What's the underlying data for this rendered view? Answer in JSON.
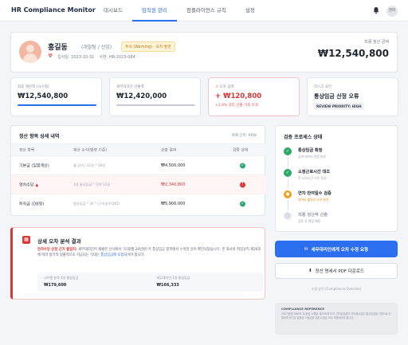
{
  "header": {
    "brand": "HR Compliance Monitor",
    "nav": [
      "대시보드",
      "임직원 관리",
      "컴플라이언스 규칙",
      "설정"
    ],
    "active_nav": "임직원 관리",
    "user_avatar": "관리"
  },
  "profile": {
    "name": "홍길동",
    "dept": "(개발팀 / 선임)",
    "badge": "주의 (Warning) · 오차 발견",
    "hire_date": "입사일: 2023-10-31",
    "emp_id": "사번: HR-2023-084",
    "total_label": "최종 정산 금액",
    "total_value": "₩12,540,800"
  },
  "stats": [
    {
      "label": "최종 계산액 (시스템)",
      "value": "₩12,540,800",
      "accent": "#2b6ff0"
    },
    {
      "label": "세무대리인 산출액",
      "value": "₩12,420,000",
      "accent": "#8a90a0"
    },
    {
      "label": "오차 금액",
      "value": "+ ₩120,800",
      "sub": "+1.0% 과다 산출 기준 초과",
      "accent": "#d93636"
    },
    {
      "label": "리스크 요인",
      "value": "통상임금 산정 오류",
      "tag": "REVIEW PRIORITY: HIGH"
    }
  ],
  "table": {
    "title": "정산 항목 상세 내역",
    "unit": "화폐 단위: KRW",
    "headers": [
      "정산 항목",
      "계산 수식(법정 기준)",
      "산출 결과",
      "검증 상태"
    ],
    "rows": [
      {
        "item": "기본급 (일할계산)",
        "formula": "월 급여 / 31일 * 28일",
        "result": "₩4,500,000",
        "status": "ok"
      },
      {
        "item": "연차수당",
        "formula": "1일 통상임금 * 잔여 12일",
        "result": "₩2,340,800",
        "status": "error"
      },
      {
        "item": "퇴직금 (DB형)",
        "formula": "평균임금 * 30 * (근속일수/365)",
        "result": "₩5,900,000",
        "status": "ok"
      }
    ]
  },
  "analysis": {
    "title": "상세 오차 분석 결과",
    "highlight": "연차수당 산정 근거 불일치:",
    "text_main": " 세무대리인이 제출한 산식에서 '식대(월 20만원)'가 통상임금 항목에서 누락된 것이 확인되었습니다. 본 회사의 취업규칙 제26조에 따라 정기적·일률적으로 지급되는 식대는 ",
    "link": "통상임금에 포함",
    "text_end": "되어야 합니다.",
    "boxes": [
      {
        "label": "시스템 분석 1일 통상임금",
        "value": "₩179,600"
      },
      {
        "label": "세무대리인 1일 통상임금",
        "value": "₩166,333"
      }
    ]
  },
  "process": {
    "title": "검증 프로세스 상태",
    "steps": [
      {
        "label": "통상임금 확정",
        "sub": "급여 데이터 연동 완료",
        "state": "done"
      },
      {
        "label": "소정근로시간 대조",
        "sub": "주 209시간 기준 정상",
        "state": "done"
      },
      {
        "label": "연차 잔여일수 검증",
        "sub": "데이터 불일치 오차 발견",
        "state": "warn"
      },
      {
        "label": "최종 정산액 산출",
        "sub": "검토 후 확정 예정",
        "state": "pending"
      }
    ]
  },
  "actions": {
    "primary": "세무대리인에게 오차 수정 요청",
    "secondary": "정산 명세서 PDF 다운로드",
    "small": "소명 승인 (Compliance Override)"
  },
  "compliance": {
    "title": "COMPLIANCE REFERENCE",
    "text": "근로기준법 제60조 및 동법 시행령 제33조에 의거, 연차유급휴가 미사용수당은 통상임금을 기준으로 산정하며 정기성·일률성·고정성을 갖춘 수당은 모두 포함되어야 합니다."
  },
  "colors": {
    "primary": "#2b6ff0",
    "danger": "#d93636",
    "success": "#2fa86b",
    "warning": "#f0a020"
  }
}
